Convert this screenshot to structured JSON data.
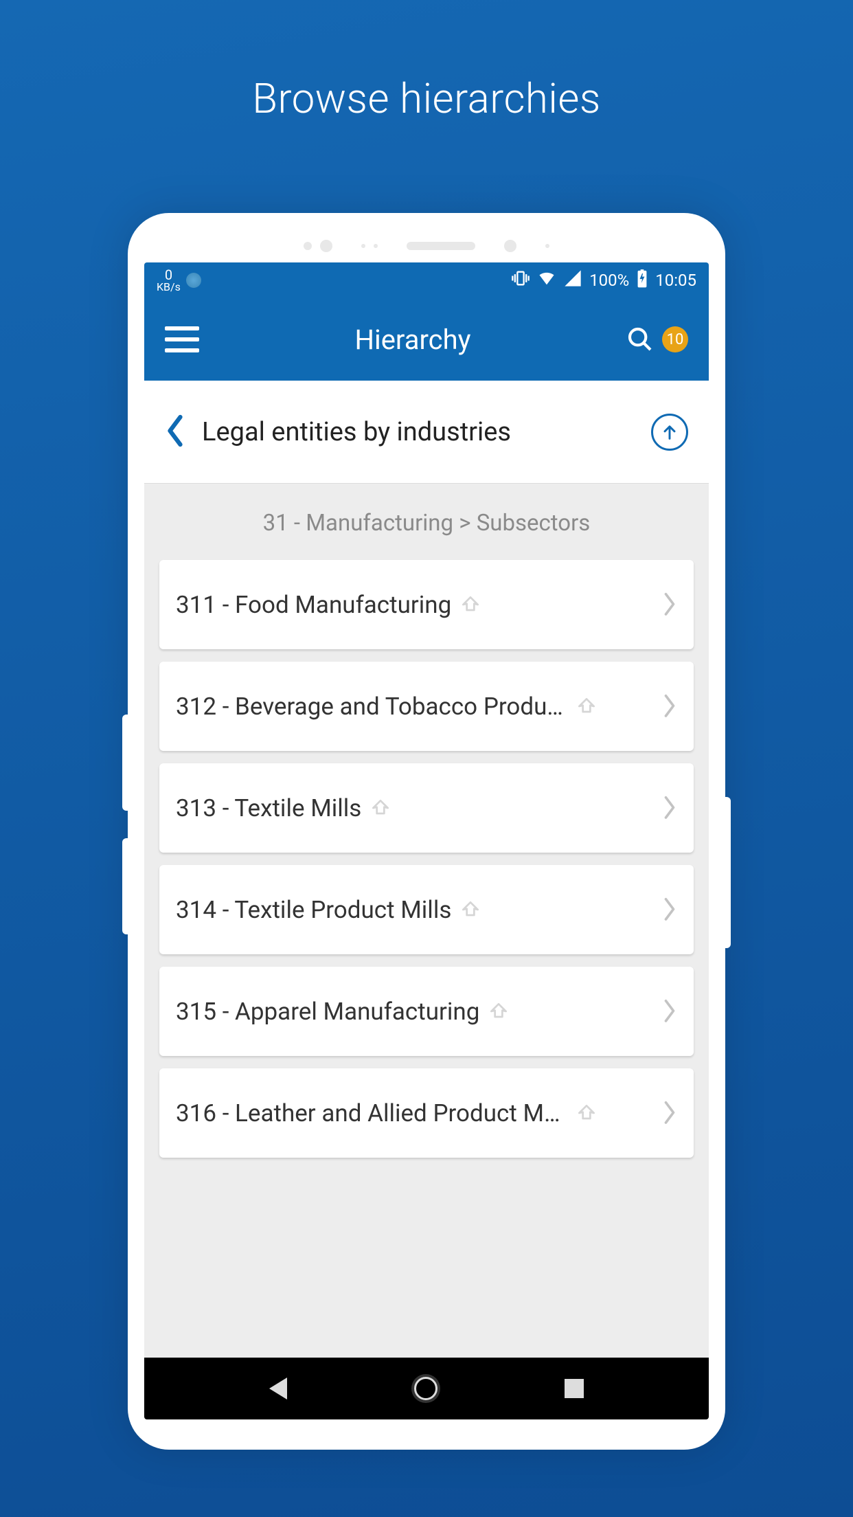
{
  "page_heading": "Browse hierarchies",
  "status": {
    "kb": "0",
    "kb_unit": "KB/s",
    "battery": "100%",
    "time": "10:05"
  },
  "appbar": {
    "title": "Hierarchy",
    "badge": "10"
  },
  "subbar": {
    "title": "Legal entities by industries"
  },
  "breadcrumb": "31 - Manufacturing > Subsectors",
  "rows": [
    {
      "label": "311 - Food Manufacturing"
    },
    {
      "label": "312 - Beverage and Tobacco Produc..."
    },
    {
      "label": "313 - Textile Mills"
    },
    {
      "label": "314 - Textile Product Mills"
    },
    {
      "label": "315 - Apparel Manufacturing"
    },
    {
      "label": "316 - Leather and Allied Product Ma..."
    }
  ]
}
